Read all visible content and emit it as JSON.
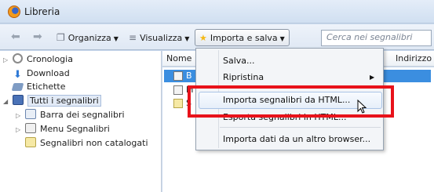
{
  "window": {
    "title": "Libreria"
  },
  "toolbar": {
    "organizza_label": "Organizza",
    "visualizza_label": "Visualizza",
    "importa_label": "Importa e salva",
    "search_placeholder": "Cerca nei segnalibri"
  },
  "sidebar": {
    "items": [
      {
        "label": "Cronologia"
      },
      {
        "label": "Download"
      },
      {
        "label": "Etichette"
      },
      {
        "label": "Tutti i segnalibri"
      },
      {
        "label": "Barra dei segnalibri"
      },
      {
        "label": "Menu Segnalibri"
      },
      {
        "label": "Segnalibri non catalogati"
      }
    ]
  },
  "list": {
    "columns": [
      "Nome",
      "Indirizzo"
    ],
    "rows": [
      "B",
      "M",
      "S"
    ]
  },
  "menu": {
    "items": [
      {
        "label": "Salva..."
      },
      {
        "label": "Ripristina"
      },
      {
        "label": "Importa segnalibri da HTML..."
      },
      {
        "label": "Esporta segnalibri in HTML..."
      },
      {
        "label": "Importa dati da un altro browser..."
      }
    ]
  },
  "colors": {
    "highlight": "#e8121a",
    "selection": "#3b8ee0"
  }
}
